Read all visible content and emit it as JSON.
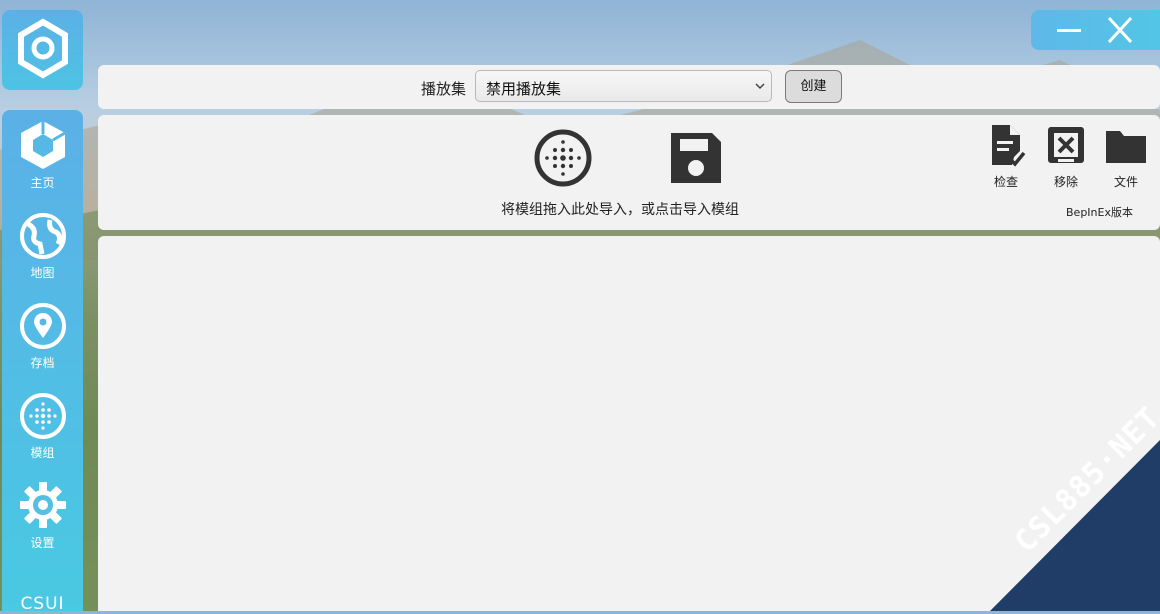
{
  "sidebar": {
    "items": [
      {
        "label": "主页",
        "icon": "cube-icon"
      },
      {
        "label": "地图",
        "icon": "globe-icon"
      },
      {
        "label": "存档",
        "icon": "map-pin-icon"
      },
      {
        "label": "模组",
        "icon": "mod-dots-icon"
      },
      {
        "label": "设置",
        "icon": "gear-icon"
      }
    ],
    "footer": "CSUI"
  },
  "playlist": {
    "label": "播放集",
    "selected": "禁用播放集",
    "create_label": "创建"
  },
  "mods": {
    "drop_hint": "将模组拖入此处导入，或点击导入模组",
    "tools": [
      {
        "label": "检查",
        "icon": "file-check-icon"
      },
      {
        "label": "移除",
        "icon": "remove-icon"
      },
      {
        "label": "文件",
        "icon": "folder-icon"
      }
    ],
    "bepinex_label": "BepInEx版本"
  },
  "watermark": "CSL885·NET",
  "colors": {
    "accent": "#52bde6",
    "panel": "#f2f2f2",
    "icon_dark": "#333333",
    "watermark_bg": "#1f3d66"
  }
}
